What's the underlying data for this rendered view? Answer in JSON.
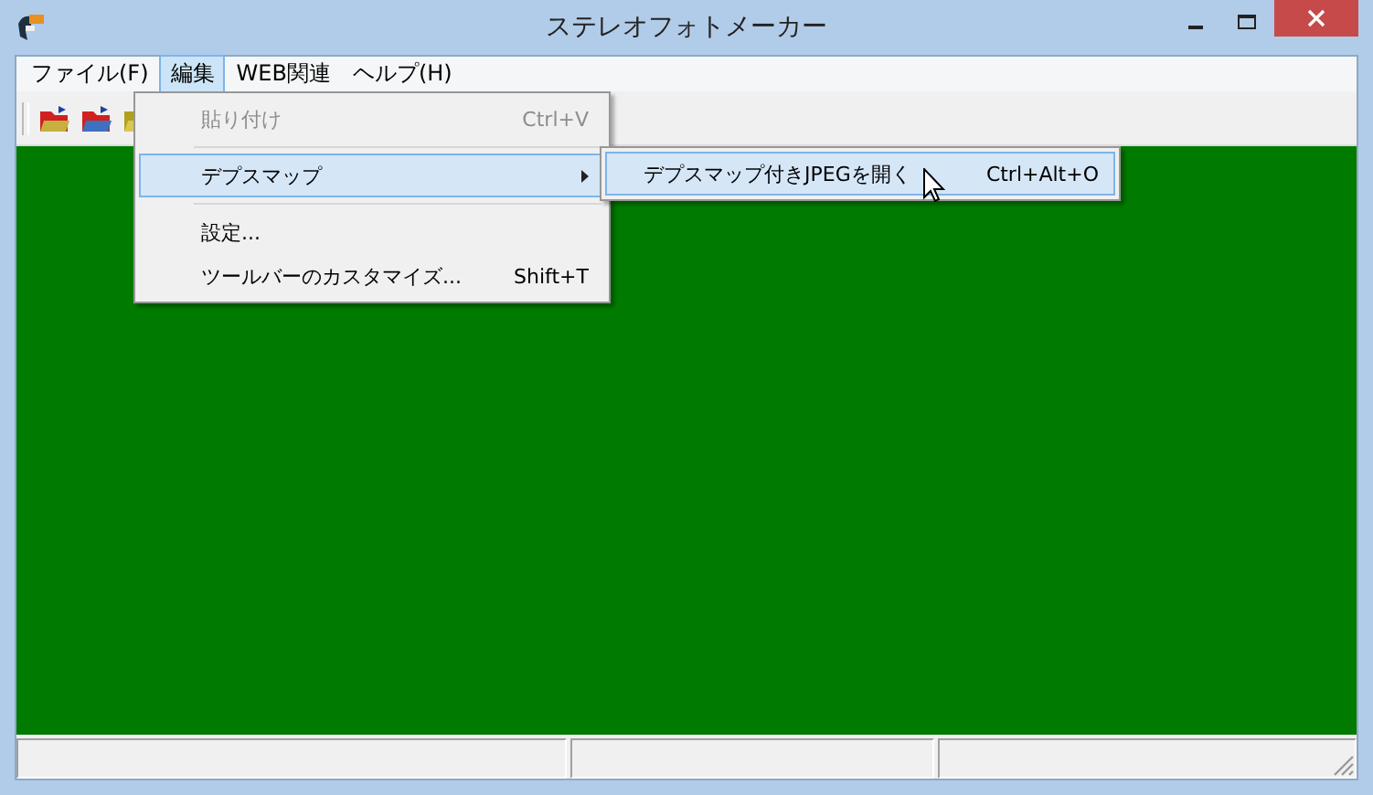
{
  "window": {
    "title": "ステレオフォトメーカー"
  },
  "menubar": [
    {
      "label": "ファイル(F)",
      "selected": false
    },
    {
      "label": "編集",
      "selected": true
    },
    {
      "label": "WEB関連",
      "selected": false
    },
    {
      "label": "ヘルプ(H)",
      "selected": false
    }
  ],
  "menu": [
    {
      "kind": "item",
      "label": "貼り付け",
      "shortcut": "Ctrl+V",
      "disabled": true,
      "selected": false,
      "submenu": false
    },
    {
      "kind": "separator"
    },
    {
      "kind": "item",
      "label": "デプスマップ",
      "disabled": false,
      "selected": true,
      "submenu": true
    },
    {
      "kind": "separator"
    },
    {
      "kind": "item",
      "label": "設定...",
      "disabled": false,
      "selected": false,
      "submenu": false
    },
    {
      "kind": "item",
      "label": "ツールバーのカスタマイズ...",
      "shortcut": "Shift+T",
      "disabled": false,
      "selected": false,
      "submenu": false
    }
  ],
  "submenu": [
    {
      "kind": "item",
      "label": "デプスマップ付きJPEGを開く",
      "shortcut": "Ctrl+Alt+O",
      "disabled": false,
      "selected": true
    }
  ]
}
